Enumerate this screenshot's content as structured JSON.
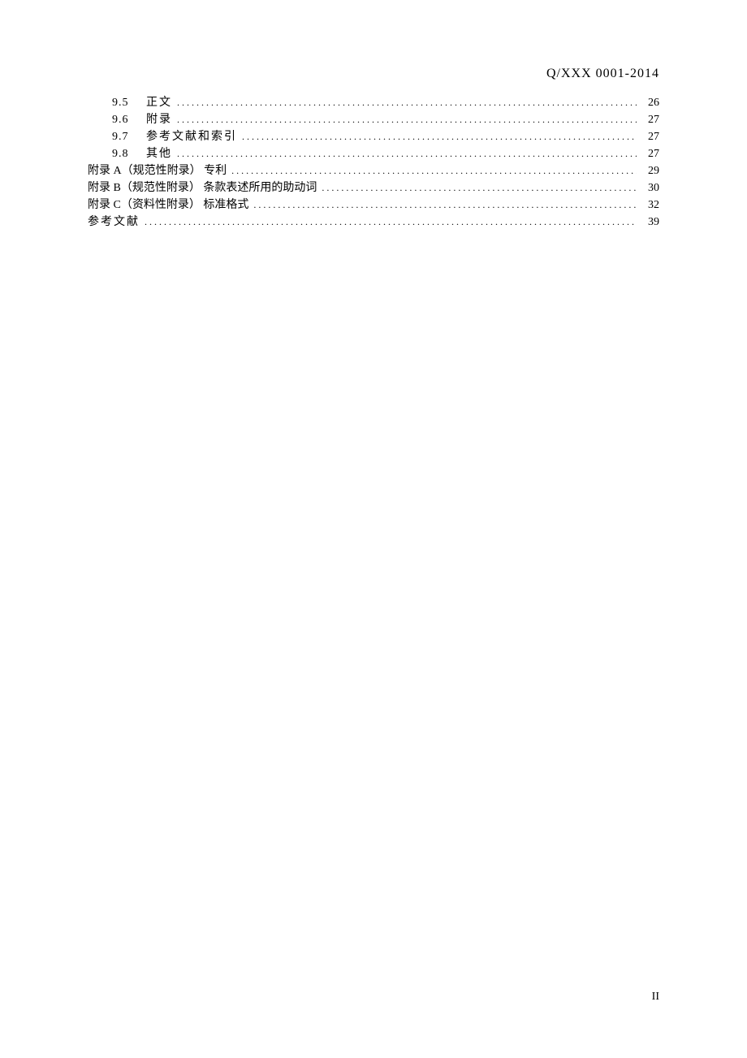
{
  "header": {
    "doc_code": "Q/XXX 0001-2014"
  },
  "toc": {
    "entries": [
      {
        "number": "9.5",
        "title": "正文",
        "page": "26",
        "indented": true,
        "compact": false
      },
      {
        "number": "9.6",
        "title": "附录",
        "page": "27",
        "indented": true,
        "compact": false
      },
      {
        "number": "9.7",
        "title": "参考文献和索引",
        "page": "27",
        "indented": true,
        "compact": false
      },
      {
        "number": "9.8",
        "title": "其他",
        "page": "27",
        "indented": true,
        "compact": false
      },
      {
        "number": "",
        "title": "附录 A（规范性附录） 专利",
        "page": "29",
        "indented": false,
        "compact": true
      },
      {
        "number": "",
        "title": "附录 B（规范性附录） 条款表述所用的助动词",
        "page": "30",
        "indented": false,
        "compact": true
      },
      {
        "number": "",
        "title": "附录 C（资料性附录） 标准格式",
        "page": "32",
        "indented": false,
        "compact": true
      },
      {
        "number": "",
        "title": "参考文献",
        "page": "39",
        "indented": false,
        "compact": false
      }
    ]
  },
  "footer": {
    "page_number": "II"
  }
}
